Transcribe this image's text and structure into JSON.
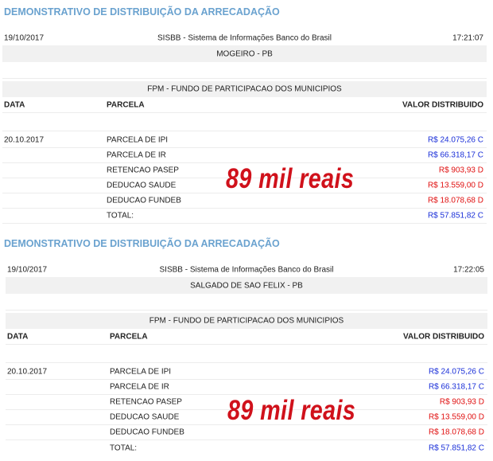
{
  "panels": [
    {
      "title": "DEMONSTRATIVO DE DISTRIBUIÇÃO DA ARRECADAÇÃO",
      "date": "19/10/2017",
      "system": "SISBB - Sistema de Informações Banco do Brasil",
      "time": "17:21:07",
      "municipality": "MOGEIRO - PB",
      "fund": "FPM - FUNDO DE PARTICIPACAO DOS MUNICIPIOS",
      "headers": {
        "data": "DATA",
        "parcela": "PARCELA",
        "valor": "VALOR DISTRIBUIDO"
      },
      "entry_date": "20.10.2017",
      "rows": [
        {
          "parcela": "PARCELA DE IPI",
          "valor": "R$ 24.075,26 C"
        },
        {
          "parcela": "PARCELA DE IR",
          "valor": "R$ 66.318,17 C"
        },
        {
          "parcela": "RETENCAO PASEP",
          "valor": "R$ 903,93 D"
        },
        {
          "parcela": "DEDUCAO SAUDE",
          "valor": "R$ 13.559,00 D"
        },
        {
          "parcela": "DEDUCAO FUNDEB",
          "valor": "R$ 18.078,68 D"
        },
        {
          "parcela": "TOTAL:",
          "valor": "R$ 57.851,82 C"
        }
      ],
      "overlay": "89 mil reais"
    },
    {
      "title": "DEMONSTRATIVO DE DISTRIBUIÇÃO DA ARRECADAÇÃO",
      "date": "19/10/2017",
      "system": "SISBB - Sistema de Informações Banco do Brasil",
      "time": "17:22:05",
      "municipality": "SALGADO DE SAO FELIX - PB",
      "fund": "FPM - FUNDO DE PARTICIPACAO DOS MUNICIPIOS",
      "headers": {
        "data": "DATA",
        "parcela": "PARCELA",
        "valor": "VALOR DISTRIBUIDO"
      },
      "entry_date": "20.10.2017",
      "rows": [
        {
          "parcela": "PARCELA DE IPI",
          "valor": "R$ 24.075,26 C"
        },
        {
          "parcela": "PARCELA DE IR",
          "valor": "R$ 66.318,17 C"
        },
        {
          "parcela": "RETENCAO PASEP",
          "valor": "R$ 903,93 D"
        },
        {
          "parcela": "DEDUCAO SAUDE",
          "valor": "R$ 13.559,00 D"
        },
        {
          "parcela": "DEDUCAO FUNDEB",
          "valor": "R$ 18.078,68 D"
        },
        {
          "parcela": "TOTAL:",
          "valor": "R$ 57.851,82 C"
        }
      ],
      "overlay": "89 mil reais"
    }
  ],
  "colors": {
    "title": "#6aa2cf",
    "credit": "#1a2fd8",
    "debit": "#e01010",
    "overlay": "#d0111b",
    "shade": "#f1f1f1"
  }
}
